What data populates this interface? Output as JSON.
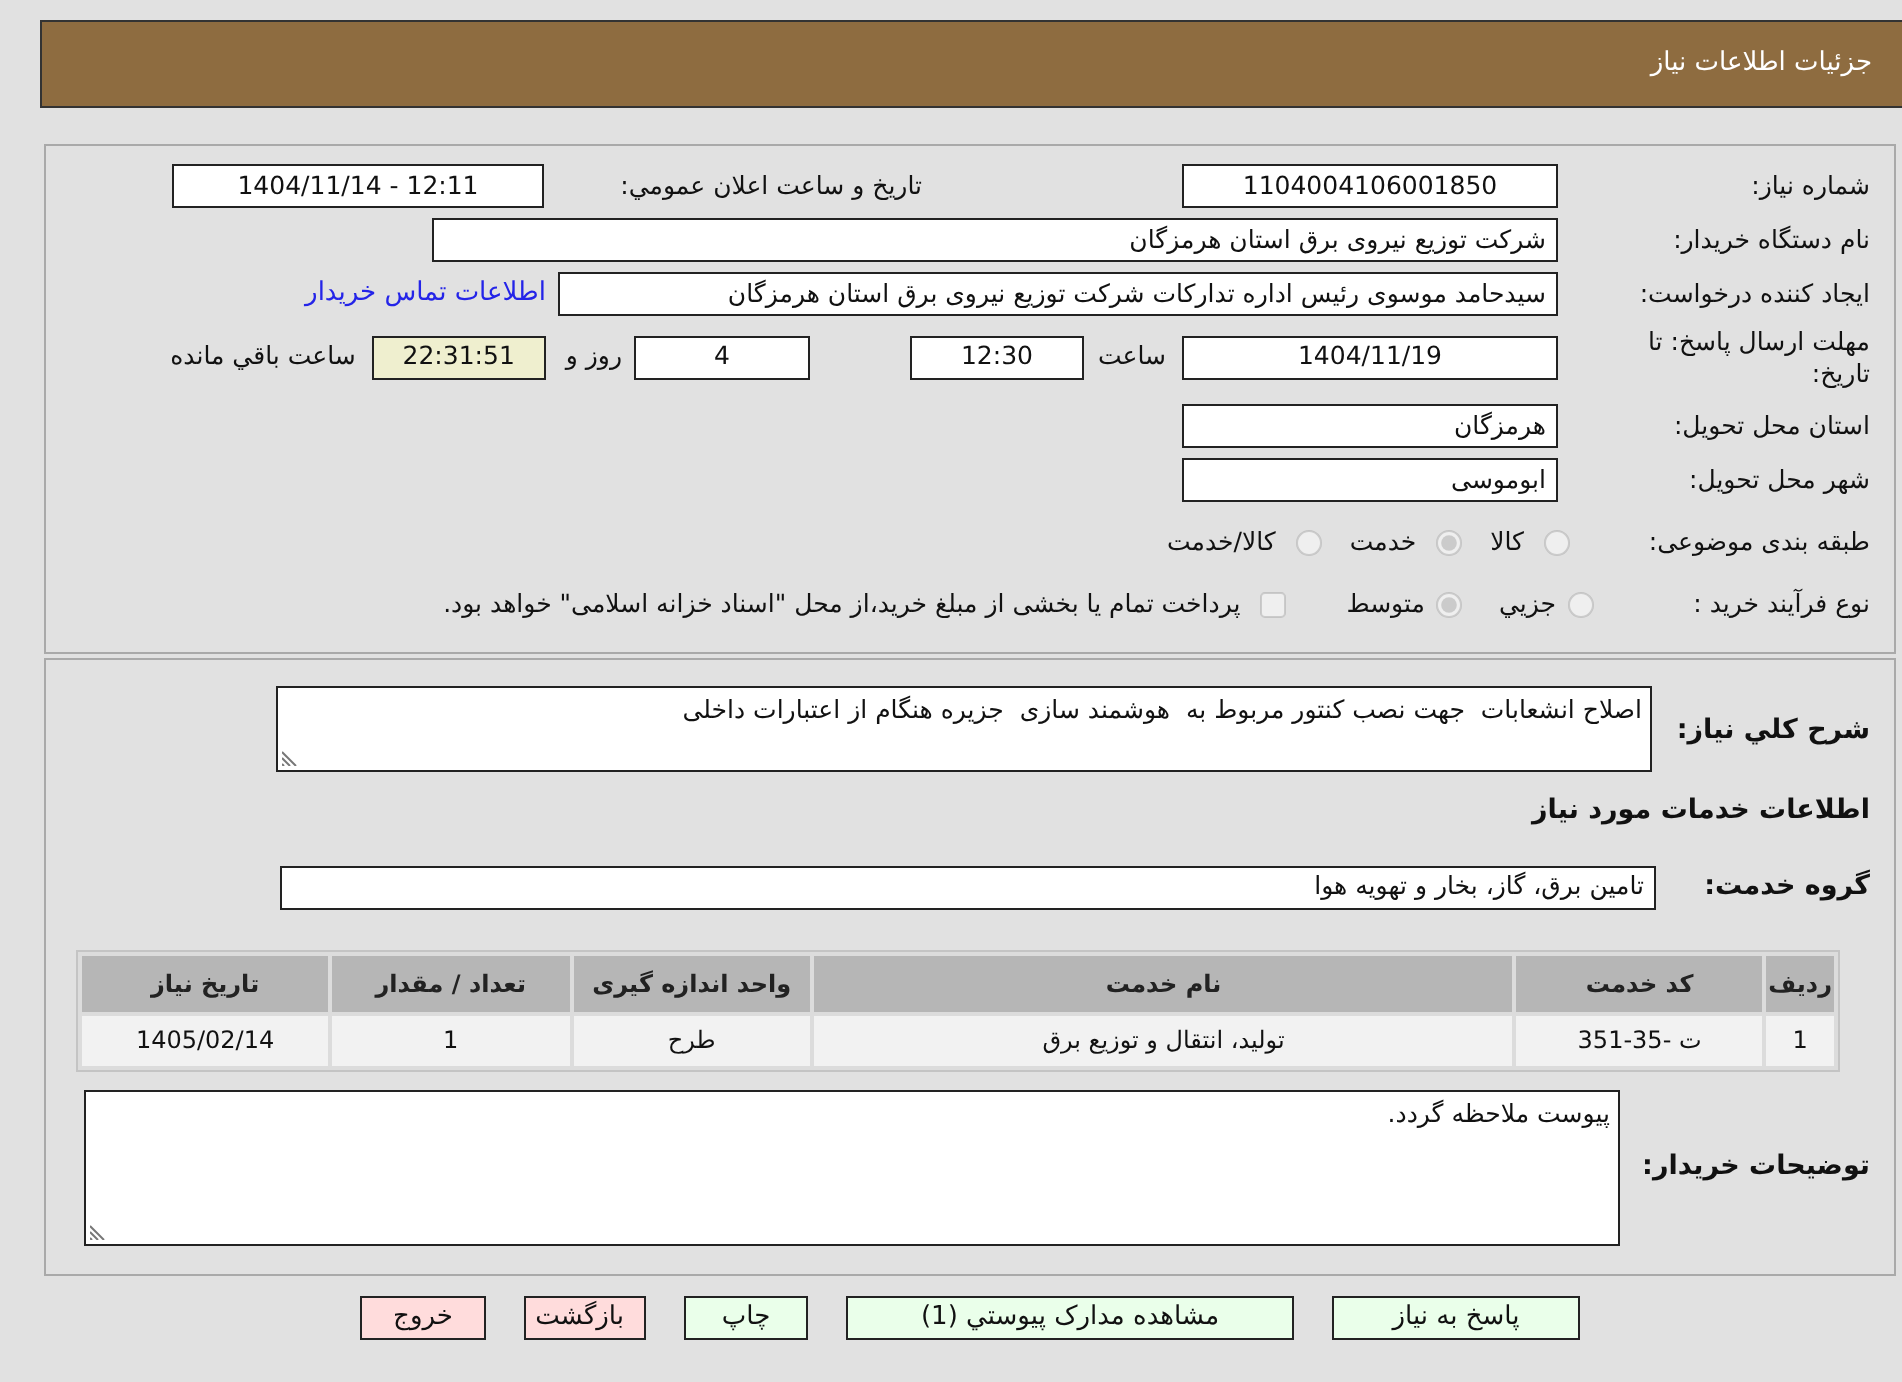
{
  "header": {
    "title": "جزئیات اطلاعات نیاز"
  },
  "need_number": {
    "label": "شماره نیاز:",
    "value": "1104004106001850"
  },
  "announcement": {
    "label": "تاریخ و ساعت اعلان عمومي:",
    "value": "1404/11/14 - 12:11"
  },
  "buyer_org": {
    "label": "نام دستگاه خریدار:",
    "value": "شرکت توزیع نیروی برق استان هرمزگان"
  },
  "requester": {
    "label": "ایجاد کننده درخواست:",
    "value": "سیدحامد موسوی رئیس اداره تدارکات شرکت توزیع نیروی برق استان هرمزگان",
    "contact_link": "اطلاعات تماس خریدار"
  },
  "deadline": {
    "label": "مهلت ارسال پاسخ: تا تاریخ:",
    "date": "1404/11/19",
    "time_label": "ساعت",
    "time": "12:30",
    "days": "4",
    "days_label": "روز و",
    "remaining": "22:31:51",
    "remaining_label": "ساعت باقي مانده"
  },
  "province": {
    "label": "استان محل تحویل:",
    "value": "هرمزگان"
  },
  "city": {
    "label": "شهر محل تحویل:",
    "value": "ابوموسی"
  },
  "category": {
    "label": "طبقه بندی موضوعی:",
    "options": [
      {
        "label": "کالا",
        "selected": false,
        "disabled": true
      },
      {
        "label": "خدمت",
        "selected": true,
        "disabled": true
      },
      {
        "label": "کالا/خدمت",
        "selected": false,
        "disabled": true
      }
    ]
  },
  "purchase_type": {
    "label": "نوع فرآیند خرید :",
    "options": [
      {
        "label": "جزيي",
        "selected": false,
        "disabled": true
      },
      {
        "label": "متوسط",
        "selected": true,
        "disabled": true
      }
    ],
    "treasury": {
      "label": "پرداخت تمام یا بخشی از مبلغ خرید،از محل \"اسناد خزانه اسلامی\" خواهد بود.",
      "checked": false,
      "disabled": true
    }
  },
  "description": {
    "label": "شرح کلي نیاز:",
    "value": "اصلاح انشعابات  جهت نصب کنتور مربوط به  هوشمند سازی  جزیره هنگام از اعتبارات داخلی"
  },
  "services_heading": "اطلاعات خدمات مورد نیاز",
  "service_group": {
    "label": "گروه خدمت:",
    "value": "تامین برق، گاز، بخار و تهویه هوا"
  },
  "table": {
    "columns": [
      "ردیف",
      "کد خدمت",
      "نام خدمت",
      "واحد اندازه گیری",
      "تعداد / مقدار",
      "تاریخ نیاز"
    ],
    "rows": [
      [
        "1",
        "ت -35-351",
        "تولید، انتقال و توزیع برق",
        "طرح",
        "1",
        "1405/02/14"
      ]
    ]
  },
  "buyer_notes": {
    "label": "توضیحات خریدار:",
    "value": "پیوست ملاحظه گردد."
  },
  "buttons": [
    {
      "label": "پاسخ به نیاز",
      "kind": "action"
    },
    {
      "label": "مشاهده مدارک پیوستي (1)",
      "kind": "action"
    },
    {
      "label": "چاپ",
      "kind": "action"
    },
    {
      "label": "بازگشت",
      "kind": "exit"
    },
    {
      "label": "خروج",
      "kind": "exit"
    }
  ]
}
